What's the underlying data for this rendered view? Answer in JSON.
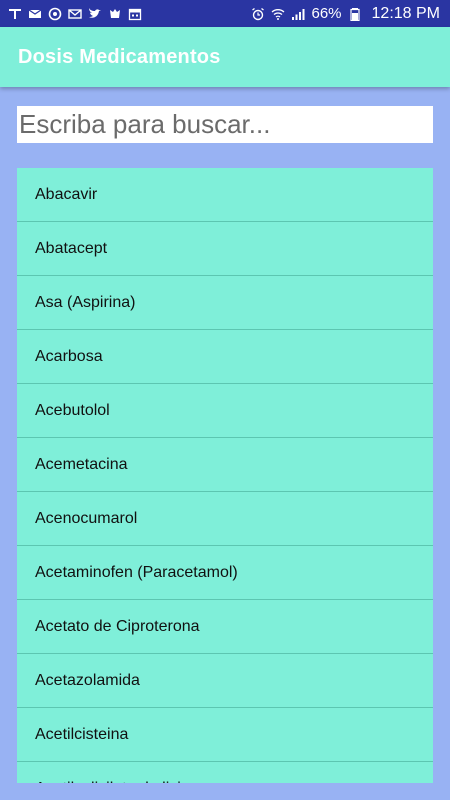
{
  "status_bar": {
    "battery": "66%",
    "time": "12:18 PM",
    "left_icons": [
      "notification-icon",
      "mail-icon",
      "sync-icon",
      "gmail-icon",
      "twitter-icon",
      "app-icon",
      "calendar-icon"
    ],
    "right_icons": [
      "alarm-icon",
      "wifi-icon",
      "signal-icon",
      "battery-icon"
    ]
  },
  "app_bar": {
    "title": "Dosis Medicamentos",
    "background": "#7fefd9"
  },
  "search": {
    "placeholder": "Escriba para buscar...",
    "value": ""
  },
  "list": {
    "items": [
      "Abacavir",
      "Abatacept",
      "Asa (Aspirina)",
      "Acarbosa",
      "Acebutolol",
      "Acemetacina",
      "Acenocumarol",
      "Acetaminofen (Paracetamol)",
      "Acetato de Ciproterona",
      "Acetazolamida",
      "Acetilcisteina",
      "Acetilsalicilato de lisina"
    ]
  },
  "colors": {
    "status_bar": "#2a35a2",
    "page_background": "#98b2f3",
    "accent": "#7fefd9"
  }
}
